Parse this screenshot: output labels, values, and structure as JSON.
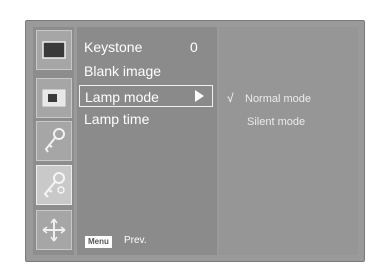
{
  "sidebar": {
    "icons": [
      {
        "name": "screen-icon"
      },
      {
        "name": "picture-in-picture-icon"
      },
      {
        "name": "key-icon"
      },
      {
        "name": "tools-icon"
      },
      {
        "name": "move-icon"
      }
    ]
  },
  "menu": {
    "items": [
      {
        "label": "Keystone",
        "value": "0"
      },
      {
        "label": "Blank image"
      },
      {
        "label": "Lamp mode"
      },
      {
        "label": "Lamp time"
      }
    ]
  },
  "submenu": {
    "options": [
      {
        "label": "Normal mode",
        "checked": true
      },
      {
        "label": "Silent mode",
        "checked": false
      }
    ],
    "check_mark": "√"
  },
  "footer": {
    "key_label": "Menu",
    "action_label": "Prev."
  }
}
